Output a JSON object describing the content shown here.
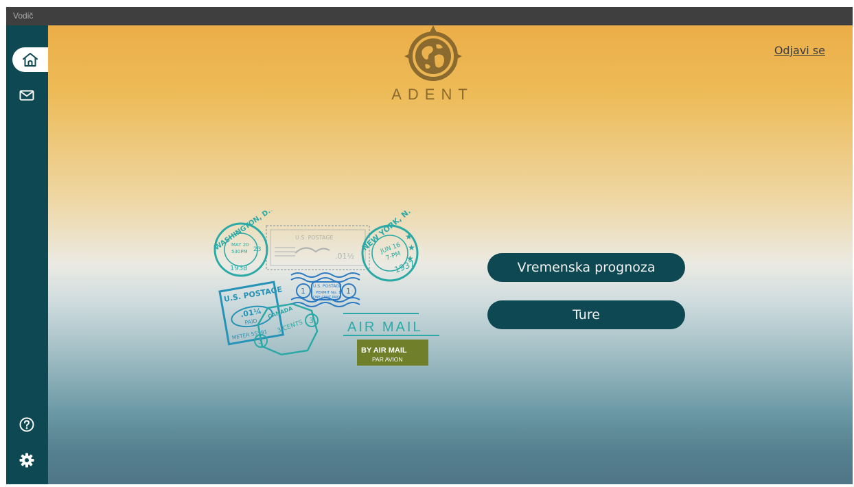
{
  "window": {
    "title": "Vodič"
  },
  "sidebar": {
    "items": [
      {
        "name": "home",
        "icon": "home-icon",
        "active": true
      },
      {
        "name": "messages",
        "icon": "mail-icon",
        "active": false
      },
      {
        "name": "help",
        "icon": "help-icon",
        "active": false
      },
      {
        "name": "settings",
        "icon": "gear-icon",
        "active": false
      }
    ]
  },
  "header": {
    "logo_text": "ADENT",
    "logout_label": "Odjavi se"
  },
  "main": {
    "buttons": [
      {
        "label": "Vremenska prognoza"
      },
      {
        "label": "Ture"
      }
    ],
    "stamps": {
      "washington": "WASHINGTON, D.C.",
      "washington_date": "MAY 20",
      "washington_time": "530PM",
      "washington_year": "1938",
      "washington_num": "23",
      "us_postage_top": "U.S. POSTAGE",
      "us_postage_value": ".01½",
      "newyork": "NEW YORK, N.Y.",
      "newyork_date": "JUN 16",
      "newyork_time": "7-PM",
      "newyork_year": "1937",
      "us_postage_left": "U.S. POSTAGE",
      "us_postage_left_value": ".01¼",
      "us_postage_left_sub": "PAID",
      "meter": "METER 55591",
      "us_postage_mid": "U.S. POSTAGE",
      "permit": "PERMIT No. 1",
      "one_cent": "ONE CENT PAID",
      "canada": "CANADA",
      "cents": "3 CENTS",
      "air_mail": "AIR MAIL",
      "by_air_mail": "BY AIR MAIL",
      "par_avion": "PAR AVION"
    }
  },
  "colors": {
    "sidebar": "#0d4853",
    "button": "#0e4953",
    "titlebar": "#3f3f3f",
    "gradient_top": "#ecae48",
    "gradient_bottom": "#4f7587",
    "logo": "#8a6a2e",
    "stamp_teal": "#2aa9a6",
    "stamp_blue": "#2b79c1",
    "stamp_olive": "#6f7f2a"
  }
}
